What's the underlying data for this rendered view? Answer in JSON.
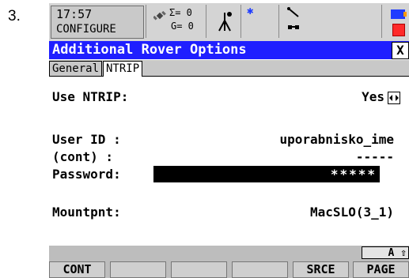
{
  "step_number": "3.",
  "status": {
    "time": "17:57",
    "mode": "CONFIGURE",
    "sats_sigma": "Σ= 0",
    "sats_g": "G= 0"
  },
  "dialog": {
    "title": "Additional Rover Options",
    "close_label": "X"
  },
  "tabs": [
    {
      "label": "General"
    },
    {
      "label": "NTRIP"
    }
  ],
  "fields": {
    "use_ntrip": {
      "label": "Use NTRIP:",
      "value": "Yes"
    },
    "user_id": {
      "label": "User ID :",
      "value": "uporabnisko_ime"
    },
    "cont": {
      "label": "(cont) :",
      "value": "-----"
    },
    "password": {
      "label": "Password:",
      "value": "*****"
    },
    "mountpnt": {
      "label": "Mountpnt:",
      "value": "MacSLO(3_1)"
    }
  },
  "shift_indicator": "A ⇧",
  "function_keys": [
    {
      "label": "CONT"
    },
    {
      "label": ""
    },
    {
      "label": ""
    },
    {
      "label": ""
    },
    {
      "label": "SRCE"
    },
    {
      "label": "PAGE"
    }
  ],
  "colors": {
    "title_bar": "#1f1fff",
    "status_bar": "#d4d4d4",
    "function_bar": "#bdbdbd"
  }
}
